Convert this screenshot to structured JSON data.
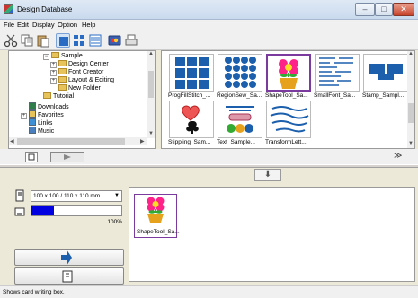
{
  "window": {
    "title": "Design Database",
    "controls": {
      "minimize": "–",
      "maximize": "□",
      "close": "✕"
    }
  },
  "menu": [
    "File",
    "Edit",
    "Display",
    "Option",
    "Help"
  ],
  "toolbar_icons": [
    "cut-icon",
    "copy-icon",
    "paste-icon",
    "large-icons-view-icon",
    "thumbnail-view-icon",
    "details-view-icon",
    "card-icon",
    "print-icon"
  ],
  "tree": {
    "items": [
      {
        "label": "Sample",
        "expander": "−"
      },
      {
        "label": "Design Center",
        "expander": "+"
      },
      {
        "label": "Font Creator",
        "expander": "+"
      },
      {
        "label": "Layout & Editing",
        "expander": "+"
      },
      {
        "label": "New Folder",
        "expander": ""
      },
      {
        "label": "Tutorial",
        "expander": ""
      },
      {
        "label": "Downloads",
        "expander": ""
      },
      {
        "label": "Favorites",
        "expander": "+"
      },
      {
        "label": "Links",
        "expander": ""
      },
      {
        "label": "Music",
        "expander": ""
      }
    ]
  },
  "gallery": {
    "items": [
      {
        "label": "ProgFillStitch_..."
      },
      {
        "label": "RegionSew_Sa..."
      },
      {
        "label": "ShapeTool_Sa..."
      },
      {
        "label": "SmallFont_Sa..."
      },
      {
        "label": "Stamp_Sampl..."
      },
      {
        "label": "Stippling_Sam..."
      },
      {
        "label": "Text_Sample..."
      },
      {
        "label": "TransformLett..."
      }
    ]
  },
  "transfer_button": "⬇",
  "collapse_icon": "≫",
  "device": {
    "card_size": "100 x 100 / 110 x 110 mm",
    "dropdown_arrow": "▼",
    "progress_percent": 25,
    "progress_text": "100%"
  },
  "card": {
    "items": [
      {
        "label": "ShapeTool_Sa..."
      }
    ]
  },
  "status": "Shows card writing box.",
  "colors": {
    "accent": "#0000e0",
    "selection": "#7b3b9e",
    "tile_blue": "#1b5fad"
  }
}
